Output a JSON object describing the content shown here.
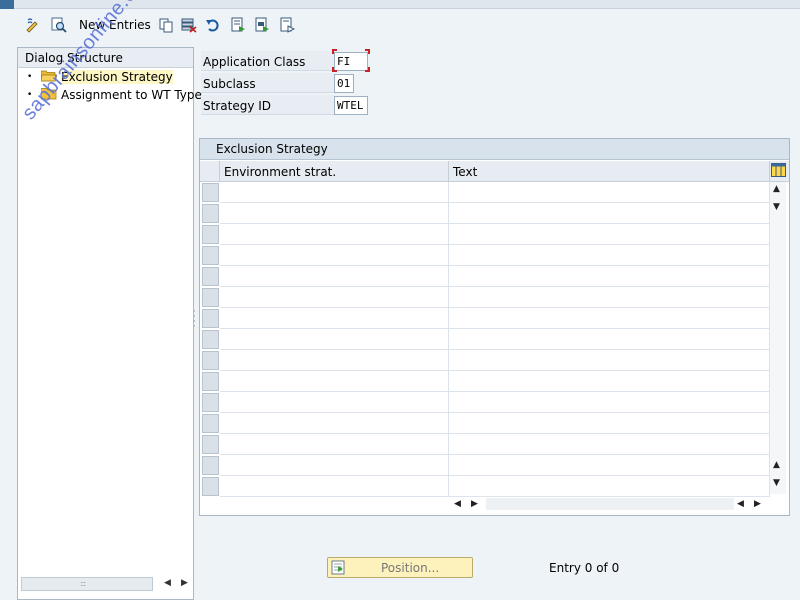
{
  "toolbar": {
    "new_entries_label": "New Entries",
    "icons": [
      "display-change-icon",
      "find-icon",
      "copy-icon",
      "delete-icon",
      "undo-icon",
      "select-all-icon",
      "select-block-icon",
      "deselect-all-icon"
    ]
  },
  "dialog_structure": {
    "title": "Dialog Structure",
    "items": [
      {
        "label": "Exclusion Strategy",
        "icon": "folder-open-icon",
        "selected": true
      },
      {
        "label": "Assignment to WT Type",
        "icon": "folder-icon",
        "selected": false
      }
    ]
  },
  "fields": {
    "application_class": {
      "label": "Application Class",
      "value": "FI"
    },
    "subclass": {
      "label": "Subclass",
      "value": "01"
    },
    "strategy_id": {
      "label": "Strategy ID",
      "value": "WTEL"
    }
  },
  "table": {
    "title": "Exclusion Strategy",
    "columns": [
      "Environment strat.",
      "Text"
    ],
    "row_count": 15
  },
  "footer": {
    "position_button_label": "Position...",
    "entry_count": "Entry 0 of 0"
  },
  "watermark": "sapbrainsonline.com",
  "colors": {
    "accent": "#3b6d9a",
    "selected_bg": "#fdf7c5",
    "button_bg": "#fdf2bb"
  }
}
